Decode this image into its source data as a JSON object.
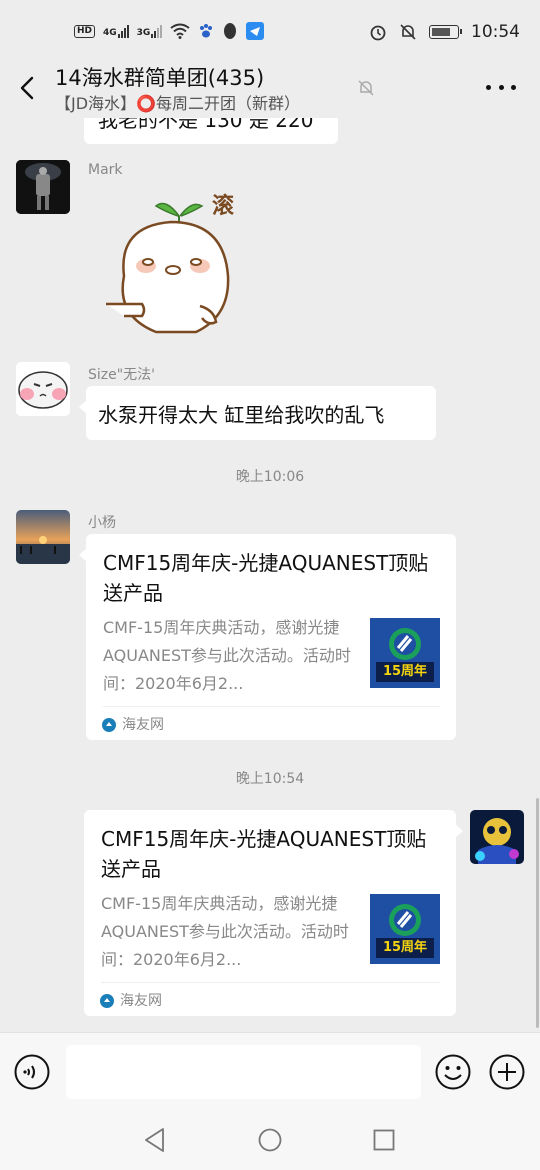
{
  "status_bar": {
    "network_hd": "HD",
    "network_4g": "4G",
    "network_3g": "3G",
    "time": "10:54",
    "battery_level": 0.8
  },
  "header": {
    "title": "14海水群简单团(435)",
    "subtitle": "【JD海水】⭕每周二开团（新群）"
  },
  "messages": {
    "partial_text": "我老的不是 130 是 220",
    "mark": {
      "sender": "Mark",
      "sticker_text": "滚"
    },
    "size": {
      "sender": "Size\"无法'",
      "text": "水泵开得太大 缸里给我吹的乱飞"
    },
    "time_1": "晚上10:06",
    "xiaoyang": {
      "sender": "小杨",
      "card_title": "CMF15周年庆-光捷AQUANEST顶贴送产品",
      "card_desc": "CMF-15周年庆典活动，感谢光捷AQUANEST参与此次活动。活动时间：2020年6月2...",
      "card_source": "海友网",
      "thumb_label": "15周年"
    },
    "time_2": "晚上10:54",
    "me": {
      "card_title": "CMF15周年庆-光捷AQUANEST顶贴送产品",
      "card_desc": "CMF-15周年庆典活动，感谢光捷AQUANEST参与此次活动。活动时间：2020年6月2...",
      "card_source": "海友网",
      "thumb_label": "15周年"
    }
  },
  "input": {
    "value": ""
  },
  "colors": {
    "background": "#ededed",
    "bubble": "#ffffff",
    "secondary_text": "#888888",
    "thumb_blue": "#1e4fa3",
    "thumb_green": "#1aa05a",
    "thumb_yellow": "#f5d30f"
  },
  "icons": [
    "back-arrow-icon",
    "bell-off-icon",
    "more-icon",
    "voice-icon",
    "emoji-icon",
    "plus-icon",
    "nav-back-icon",
    "nav-home-icon",
    "nav-recent-icon"
  ]
}
